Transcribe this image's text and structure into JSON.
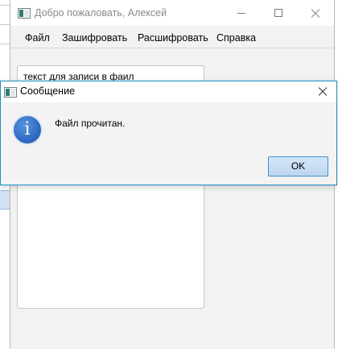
{
  "main_window": {
    "title": "Добро пожаловать, Алексей",
    "menu": [
      "Файл",
      "Зашифровать",
      "Расшифровать",
      "Справка"
    ],
    "text_area_value": "текст для записи в фаил"
  },
  "dialog": {
    "title": "Сообщение",
    "message": "Файл прочитан.",
    "icon_glyph": "i",
    "ok_label": "OK"
  },
  "colors": {
    "dialog_border": "#1c8ec8",
    "ok_button_border": "#3f8ed2",
    "info_icon": "#2f6cc4"
  },
  "icons": [
    "app-icon",
    "info-icon",
    "close-icon",
    "minimize-icon",
    "maximize-icon"
  ]
}
